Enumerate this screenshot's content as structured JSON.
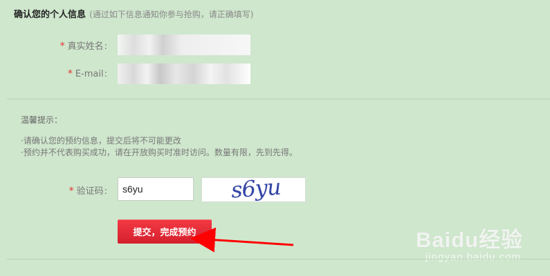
{
  "section": {
    "title": "确认您的个人信息",
    "note": "(通过如下信息通知你参与抢购，请正确填写)"
  },
  "fields": {
    "required_mark": "*",
    "name_label": "真实姓名",
    "email_label": "E-mail",
    "separator": ":"
  },
  "tips": {
    "title": "温馨提示：",
    "line1": "·请确认您的预约信息，提交后将不可能更改",
    "line2": "·预约并不代表购买成功，请在开放购买时准时访问。数量有限，先到先得。"
  },
  "captcha": {
    "label": "验证码",
    "value": "s6yu",
    "image_text": "s6yu"
  },
  "submit": {
    "label": "提交，完成预约"
  },
  "watermark": {
    "brand": "Baidu经验",
    "url": "jingyan.baidu.com"
  },
  "colors": {
    "background": "#cfe7cd",
    "required": "#e33232",
    "button": "#e52b35",
    "arrow": "#ff0000"
  }
}
